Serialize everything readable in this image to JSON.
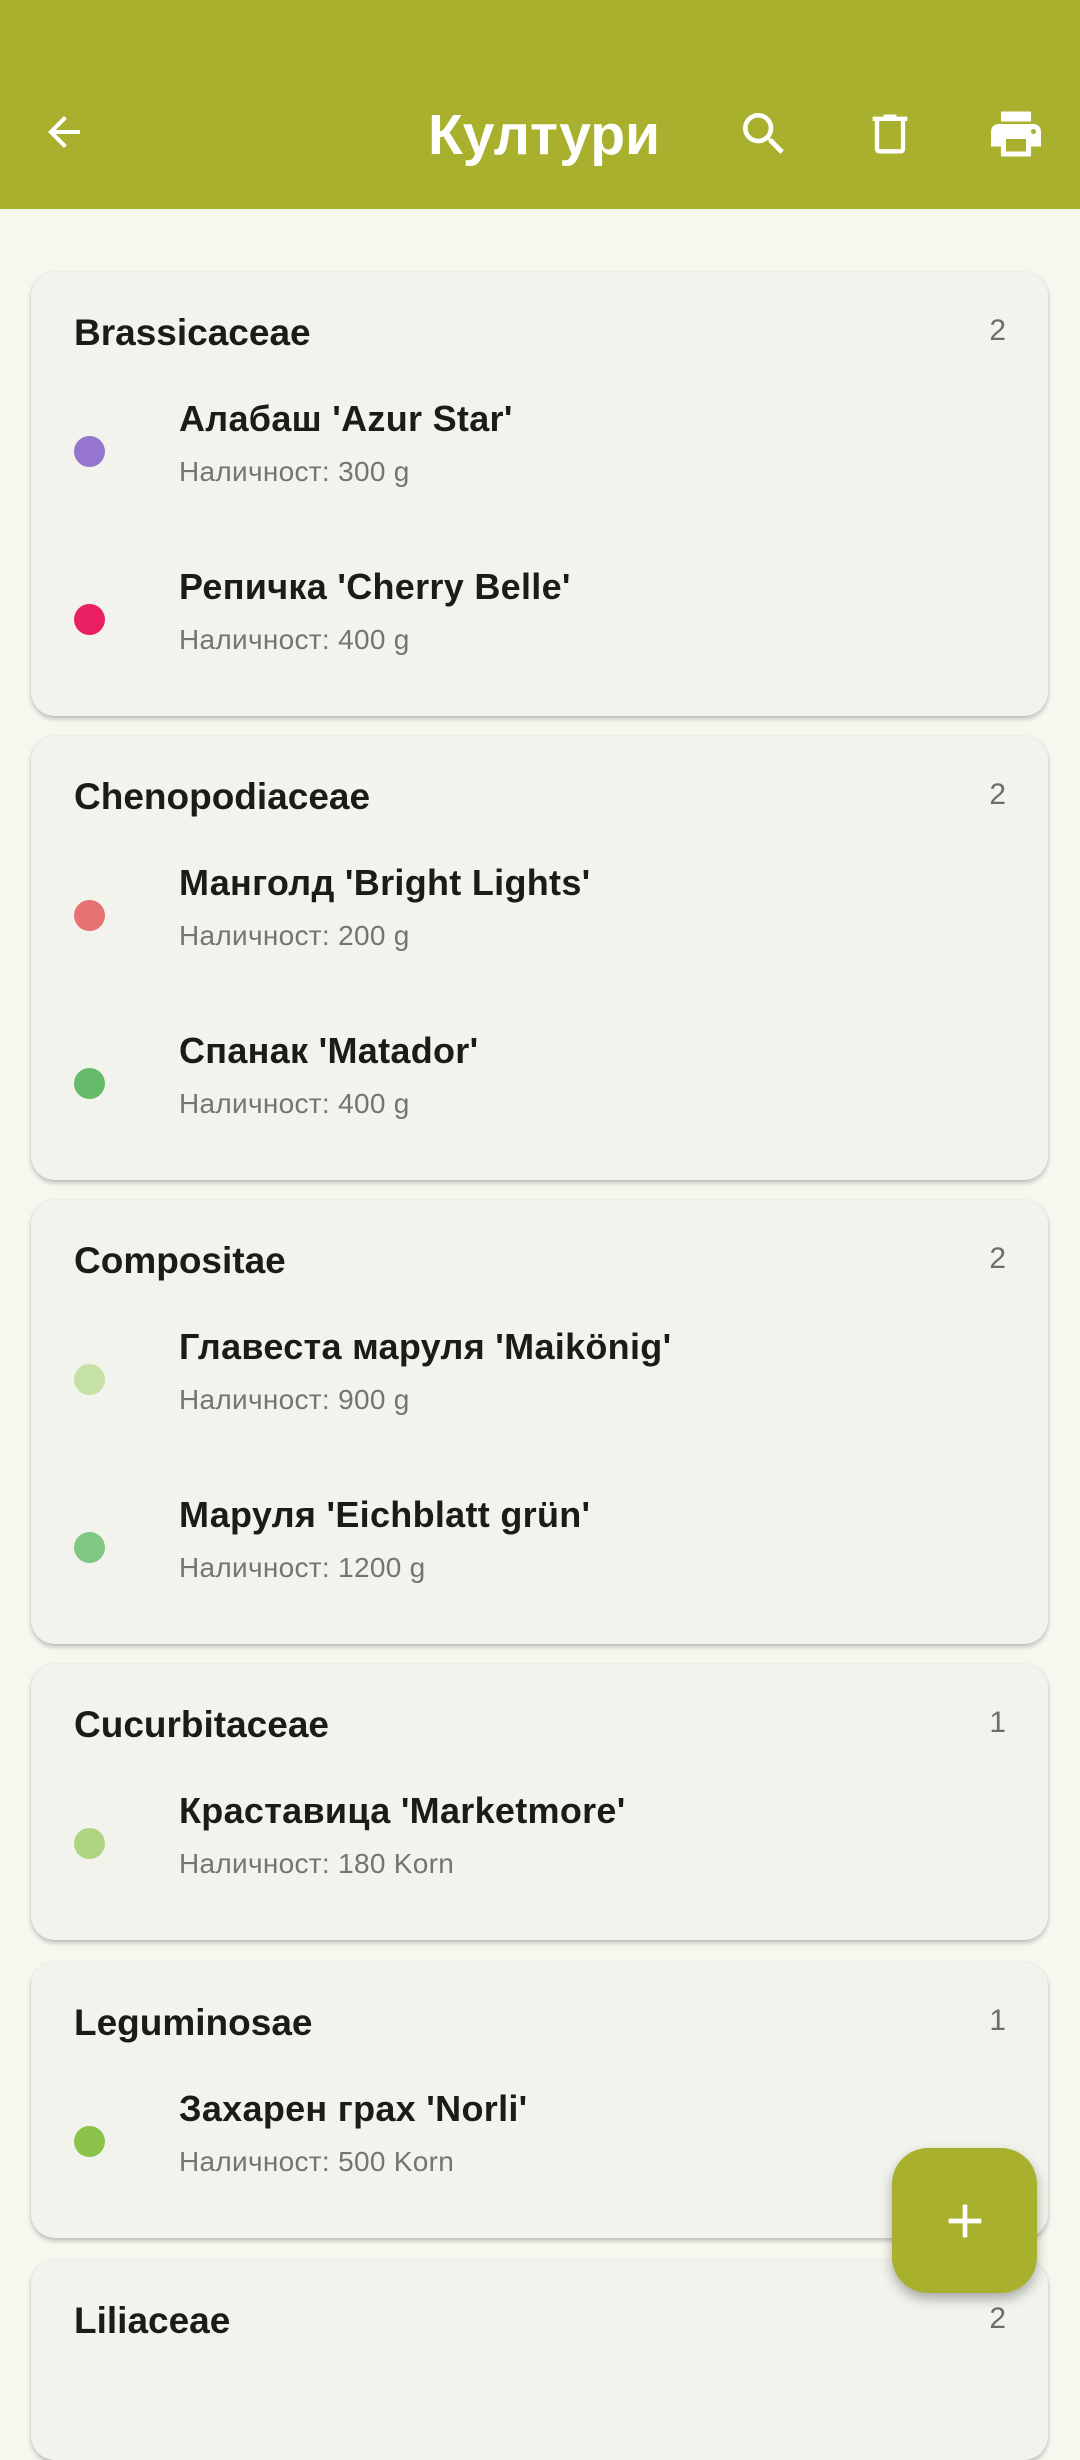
{
  "appbar": {
    "title": "Култури",
    "back_icon": "arrow-back-icon",
    "search_icon": "search-icon",
    "delete_icon": "trash-icon",
    "print_icon": "print-icon",
    "color": "#a9b02d"
  },
  "groups": [
    {
      "family": "Brassicaceae",
      "count": "2",
      "items": [
        {
          "name": "Алабаш 'Azur Star'",
          "stock": "Наличност: 300 g",
          "color": "#9575cd"
        },
        {
          "name": "Репичка 'Cherry Belle'",
          "stock": "Наличност: 400 g",
          "color": "#e91e63"
        }
      ]
    },
    {
      "family": "Chenopodiaceae",
      "count": "2",
      "items": [
        {
          "name": "Манголд 'Bright Lights'",
          "stock": "Наличност: 200 g",
          "color": "#e57373"
        },
        {
          "name": "Спанак 'Matador'",
          "stock": "Наличност: 400 g",
          "color": "#66bb6a"
        }
      ]
    },
    {
      "family": "Compositae",
      "count": "2",
      "items": [
        {
          "name": "Главеста маруля 'Maikönig'",
          "stock": "Наличност: 900 g",
          "color": "#c5e1a5"
        },
        {
          "name": "Маруля 'Eichblatt grün'",
          "stock": "Наличност: 1200 g",
          "color": "#81c784"
        }
      ]
    },
    {
      "family": "Cucurbitaceae",
      "count": "1",
      "items": [
        {
          "name": "Краставица 'Marketmore'",
          "stock": "Наличност: 180 Korn",
          "color": "#aed581"
        }
      ]
    },
    {
      "family": "Leguminosae",
      "count": "1",
      "items": [
        {
          "name": "Захарен грах 'Norli'",
          "stock": "Наличност: 500 Korn",
          "color": "#8bc34a"
        }
      ]
    },
    {
      "family": "Liliaceae",
      "count": "2",
      "items": []
    }
  ],
  "fab": {
    "icon": "plus-icon"
  }
}
